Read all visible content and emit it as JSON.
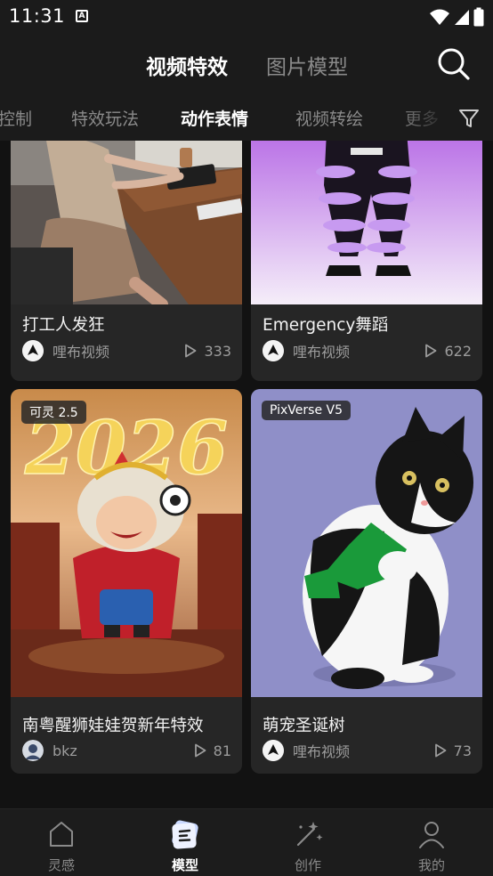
{
  "status_bar": {
    "time": "11:31",
    "app_icon_letter": "A"
  },
  "header": {
    "tabs": [
      {
        "label": "视频特效",
        "active": true
      },
      {
        "label": "图片模型",
        "active": false
      }
    ]
  },
  "subtabs": {
    "items": [
      {
        "label": "控制",
        "active": false
      },
      {
        "label": "特效玩法",
        "active": false
      },
      {
        "label": "动作表情",
        "active": true
      },
      {
        "label": "视频转绘",
        "active": false
      },
      {
        "label": "更多",
        "active": false
      }
    ]
  },
  "cards": [
    {
      "title": "打工人发狂",
      "author": "哩布视频",
      "plays": "333",
      "badge": ""
    },
    {
      "title": "Emergency舞蹈",
      "author": "哩布视频",
      "plays": "622",
      "badge": ""
    },
    {
      "title": "南粤醒狮娃娃贺新年特效",
      "author": "bkz",
      "plays": "81",
      "badge": "可灵 2.5",
      "image_text": "2026"
    },
    {
      "title": "萌宠圣诞树",
      "author": "哩布视频",
      "plays": "73",
      "badge": "PixVerse V5"
    }
  ],
  "bottom_nav": {
    "items": [
      {
        "label": "灵感",
        "icon": "home-icon",
        "active": false
      },
      {
        "label": "模型",
        "icon": "model-icon",
        "active": true
      },
      {
        "label": "创作",
        "icon": "magic-wand-icon",
        "active": false
      },
      {
        "label": "我的",
        "icon": "person-icon",
        "active": false
      }
    ]
  },
  "colors": {
    "background": "#121212",
    "surface": "#1b1b1b",
    "card": "#262626",
    "text_primary": "#ffffff",
    "text_secondary": "#8a8a8a",
    "nav_active_icon": "#c9d8ff"
  }
}
